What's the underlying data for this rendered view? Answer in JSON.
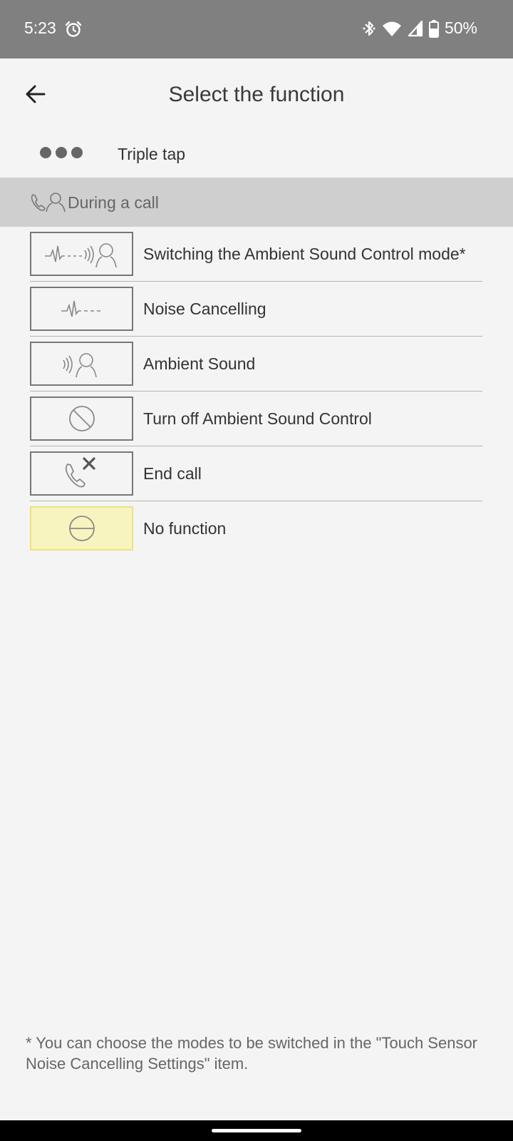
{
  "status_bar": {
    "time": "5:23",
    "battery": "50%"
  },
  "header": {
    "title": "Select the function"
  },
  "gesture": {
    "label": "Triple tap"
  },
  "section": {
    "label": "During a call"
  },
  "functions": [
    {
      "label": "Switching the Ambient Sound Control mode*",
      "icon": "nc-ambient-switch-icon",
      "selected": false
    },
    {
      "label": "Noise Cancelling",
      "icon": "noise-cancelling-icon",
      "selected": false
    },
    {
      "label": "Ambient Sound",
      "icon": "ambient-sound-icon",
      "selected": false
    },
    {
      "label": "Turn off Ambient Sound Control",
      "icon": "prohibited-icon",
      "selected": false
    },
    {
      "label": "End call",
      "icon": "end-call-icon",
      "selected": false
    },
    {
      "label": "No function",
      "icon": "no-function-icon",
      "selected": true
    }
  ],
  "footnote": "* You can choose the modes to be switched in the \"Touch Sensor Noise Cancelling Settings\" item.",
  "colors": {
    "status_bar": "#808080",
    "section_bar": "#cfcfcf",
    "selected_bg": "#f8f4c0",
    "selected_border": "#ece37c"
  }
}
